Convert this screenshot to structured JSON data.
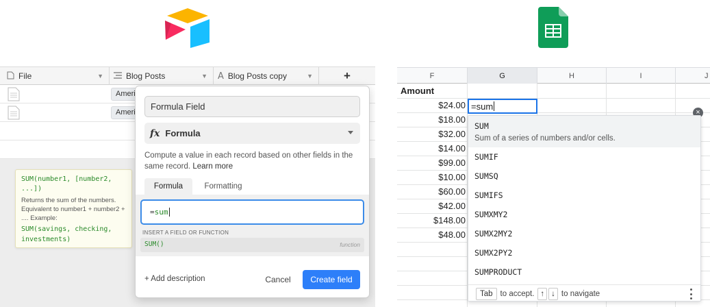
{
  "airtable": {
    "columns": [
      {
        "icon": "document-icon",
        "label": "File"
      },
      {
        "icon": "lines-icon",
        "label": "Blog Posts"
      },
      {
        "icon": "text-a-icon",
        "label": "Blog Posts copy"
      }
    ],
    "add_column_label": "+",
    "rows": [
      {
        "pill": "Ameri"
      },
      {
        "pill": "Ameri"
      }
    ],
    "tooltip": {
      "signature": "SUM(number1, [number2, ...])",
      "description": "Returns the sum of the numbers. Equivalent to number1 + number2 + .... Example:",
      "example": "SUM(savings, checking, investments)"
    },
    "dialog": {
      "field_name": "Formula Field",
      "type_icon": "fx",
      "type_label": "Formula",
      "description": "Compute a value in each record based on other fields in the same record.",
      "learn_more": "Learn more",
      "tabs": [
        "Formula",
        "Formatting"
      ],
      "formula_prefix": "=",
      "formula_fn": "sum",
      "insert_label": "INSERT A FIELD OR FUNCTION",
      "suggestion_name": "SUM()",
      "suggestion_kind": "function",
      "add_description": "+ Add description",
      "cancel_label": "Cancel",
      "create_label": "Create field"
    },
    "accent": "#2d7ff9"
  },
  "sheets": {
    "columns": [
      "F",
      "G",
      "H",
      "I",
      "J"
    ],
    "selected_column": "G",
    "header": "Amount",
    "values": [
      "$24.00",
      "$18.00",
      "$32.00",
      "$14.00",
      "$99.00",
      "$10.00",
      "$60.00",
      "$42.00",
      "$148.00",
      "$48.00"
    ],
    "active_cell_text": "=sum",
    "close_icon": "×",
    "autocomplete": {
      "first": {
        "name": "SUM",
        "description": "Sum of a series of numbers and/or cells."
      },
      "items": [
        "SUMIF",
        "SUMSQ",
        "SUMIFS",
        "SUMXMY2",
        "SUMX2MY2",
        "SUMX2PY2",
        "SUMPRODUCT"
      ],
      "footer": {
        "key_tab": "Tab",
        "accept": "to accept.",
        "up": "↑",
        "down": "↓",
        "navigate": "to navigate"
      }
    },
    "accent": "#1a73e8"
  }
}
